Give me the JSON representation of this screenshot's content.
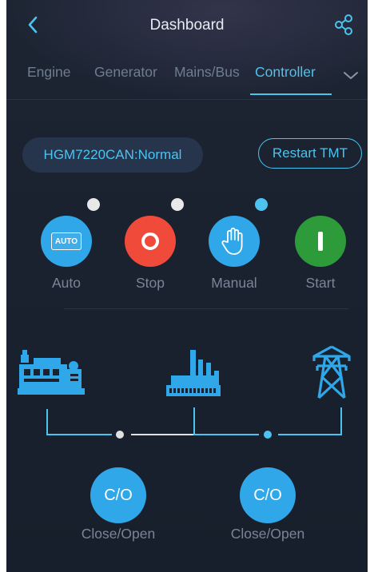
{
  "header": {
    "title": "Dashboard",
    "back_icon": "chevron-left-icon",
    "share_icon": "share-icon"
  },
  "tabs": [
    {
      "label": "Engine",
      "active": false
    },
    {
      "label": "Generator",
      "active": false
    },
    {
      "label": "Mains/Bus",
      "active": false
    },
    {
      "label": "Controller",
      "active": true
    }
  ],
  "tabs_more_icon": "chevron-down-icon",
  "controller": {
    "status": "HGM7220CAN:Normal",
    "restart_label": "Restart TMT"
  },
  "modes": [
    {
      "label": "Auto",
      "icon_text": "AUTO",
      "color": "#2fa7e8",
      "indicator": "#e8e8e8"
    },
    {
      "label": "Stop",
      "color": "#f04a3a",
      "indicator": "#e8e8e8"
    },
    {
      "label": "Manual",
      "color": "#2fa7e8",
      "indicator": "#4cc3f0"
    },
    {
      "label": "Start",
      "color": "#2e9b3a"
    }
  ],
  "diagram": {
    "generator_icon": "generator-icon",
    "load_icon": "factory-icon",
    "mains_icon": "power-tower-icon",
    "breakers": [
      {
        "label": "C/O",
        "caption": "Close/Open"
      },
      {
        "label": "C/O",
        "caption": "Close/Open"
      }
    ]
  },
  "colors": {
    "accent": "#4cc3f0",
    "background": "#1a2230",
    "text_muted": "#7a8596"
  }
}
